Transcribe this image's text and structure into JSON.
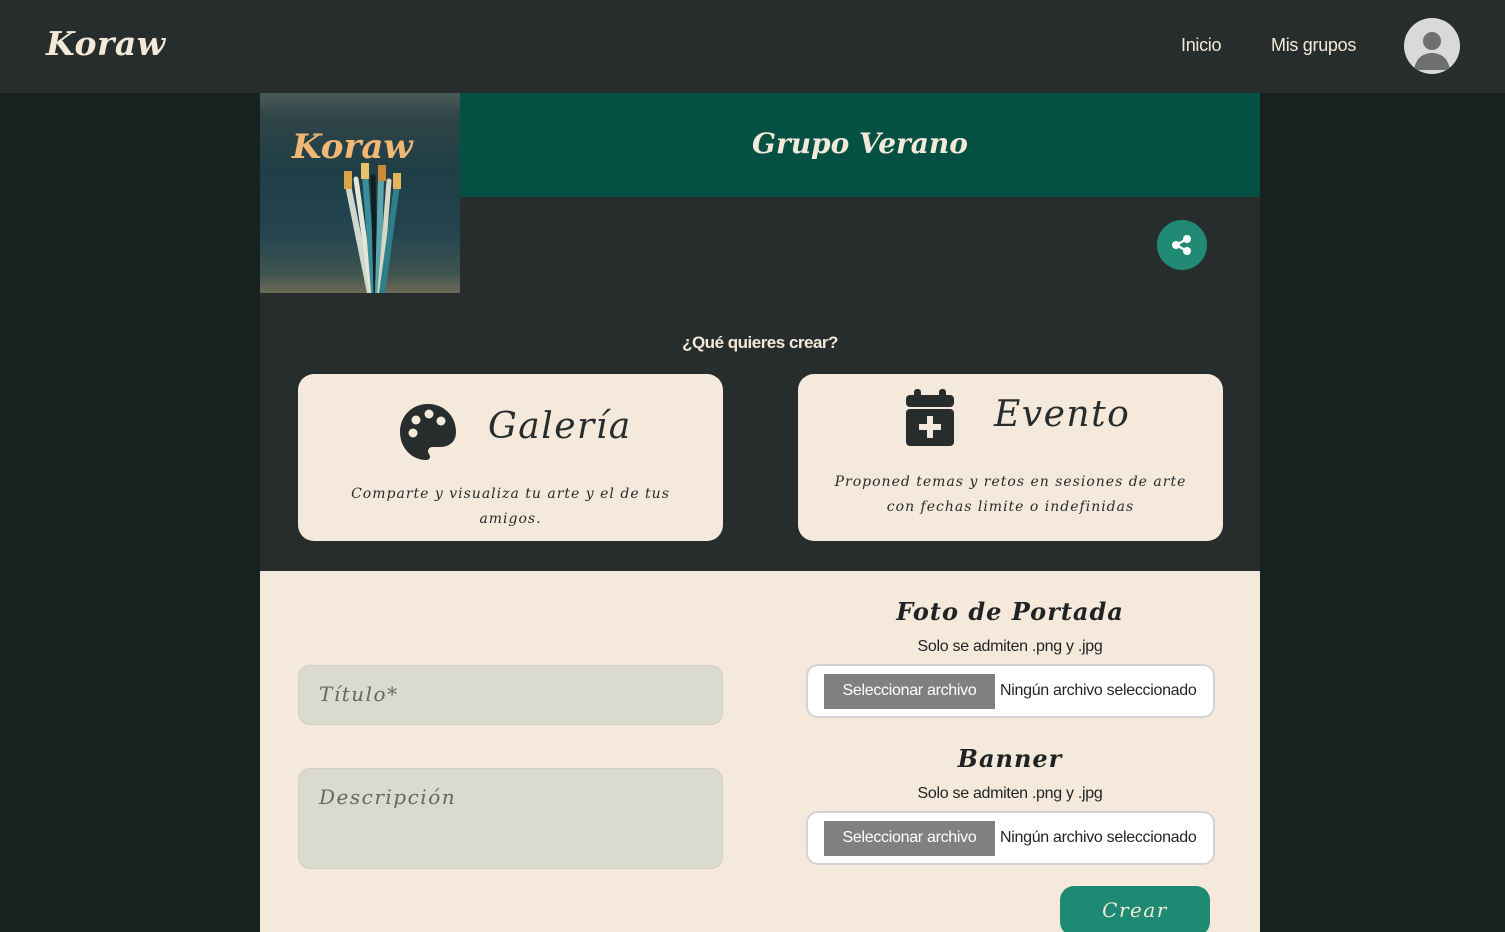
{
  "navbar": {
    "brand": "Koraw",
    "links": [
      "Inicio",
      "Mis grupos"
    ],
    "avatar_icon": "user-avatar-icon"
  },
  "group": {
    "image_logo_text": "Koraw",
    "title": "Grupo Verano",
    "share_icon": "share-icon"
  },
  "create": {
    "question": "¿Qué quieres crear?",
    "cards": [
      {
        "title": "Galería",
        "description": "Comparte y visualiza tu arte y el de tus amigos.",
        "icon": "palette-icon"
      },
      {
        "title": "Evento",
        "description": "Proponed temas y retos en sesiones de arte con fechas limite o indefinidas",
        "icon": "calendar-plus-icon"
      }
    ]
  },
  "form": {
    "title_placeholder": "Título*",
    "description_placeholder": "Descripción",
    "cover": {
      "heading": "Foto de Portada",
      "hint": "Solo se admiten .png y .jpg",
      "button": "Seleccionar archivo",
      "status": "Ningún archivo seleccionado"
    },
    "banner": {
      "heading": "Banner",
      "hint": "Solo se admiten .png y .jpg",
      "button": "Seleccionar archivo",
      "status": "Ningún archivo seleccionado"
    },
    "submit": "Crear"
  },
  "colors": {
    "navbar": "#272c2d",
    "background": "#172120",
    "header_band": "#045144",
    "accent": "#208a74",
    "card": "#f4e9da",
    "brand_text": "#f3e9d9"
  }
}
